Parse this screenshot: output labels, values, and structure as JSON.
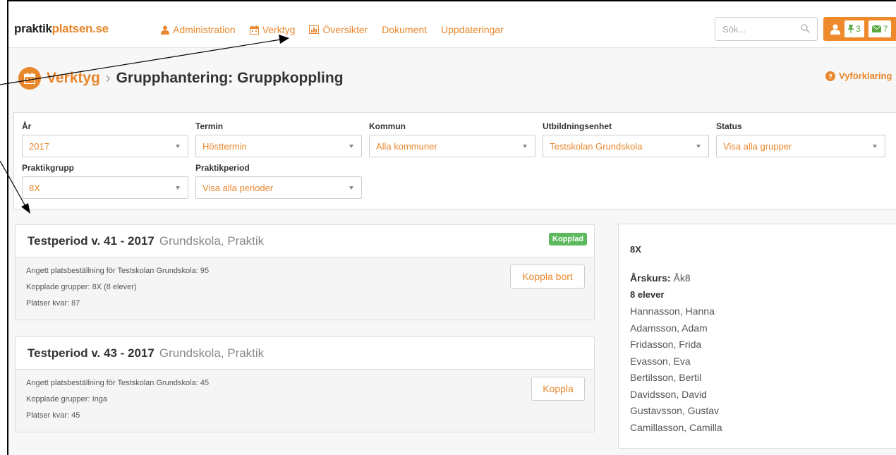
{
  "logo": {
    "part1": "praktik",
    "part2": "platsen.se"
  },
  "nav": [
    {
      "label": "Administration",
      "icon": "user-icon"
    },
    {
      "label": "Verktyg",
      "icon": "calendar-icon"
    },
    {
      "label": "Översikter",
      "icon": "bar-chart-icon"
    },
    {
      "label": "Dokument",
      "icon": ""
    },
    {
      "label": "Uppdateringar",
      "icon": ""
    }
  ],
  "search": {
    "placeholder": "Sök..."
  },
  "user": {
    "pins": "3",
    "messages": "7"
  },
  "breadcrumb": {
    "section": "Verktyg",
    "separator": "›",
    "page": "Grupphantering: Gruppkoppling"
  },
  "help": {
    "label": "Vyförklaring"
  },
  "filters": {
    "year": {
      "label": "År",
      "value": "2017"
    },
    "term": {
      "label": "Termin",
      "value": "Hösttermin"
    },
    "municipality": {
      "label": "Kommun",
      "value": "Alla kommuner"
    },
    "unit": {
      "label": "Utbildningsenhet",
      "value": "Testskolan Grundskola"
    },
    "status": {
      "label": "Status",
      "value": "Visa alla grupper"
    },
    "group": {
      "label": "Praktikgrupp",
      "value": "8X"
    },
    "period": {
      "label": "Praktikperiod",
      "value": "Visa alla perioder"
    }
  },
  "periods": [
    {
      "name": "Testperiod v. 41 - 2017",
      "type": "Grundskola, Praktik",
      "badge": "Kopplad",
      "ordered": "Angett platsbeställning för Testskolan Grundskola: 95",
      "groups": "Kopplade grupper: 8X (8 elever)",
      "remaining": "Platser kvar: 87",
      "button": "Koppla bort"
    },
    {
      "name": "Testperiod v. 43 - 2017",
      "type": "Grundskola, Praktik",
      "ordered": "Angett platsbeställning för Testskolan Grundskola: 45",
      "groups": "Kopplade grupper: Inga",
      "remaining": "Platser kvar: 45",
      "button": "Koppla"
    }
  ],
  "group_panel": {
    "name": "8X",
    "grade_label": "Årskurs:",
    "grade_value": "Åk8",
    "count": "8 elever",
    "students": [
      "Hannasson, Hanna",
      "Adamsson, Adam",
      "Fridasson, Frida",
      "Evasson, Eva",
      "Bertilsson, Bertil",
      "Davidsson, David",
      "Gustavsson, Gustav",
      "Camillasson, Camilla"
    ]
  },
  "colors": {
    "accent": "#e8872c",
    "success": "#5cb85c",
    "background": "#f7f7f7"
  }
}
